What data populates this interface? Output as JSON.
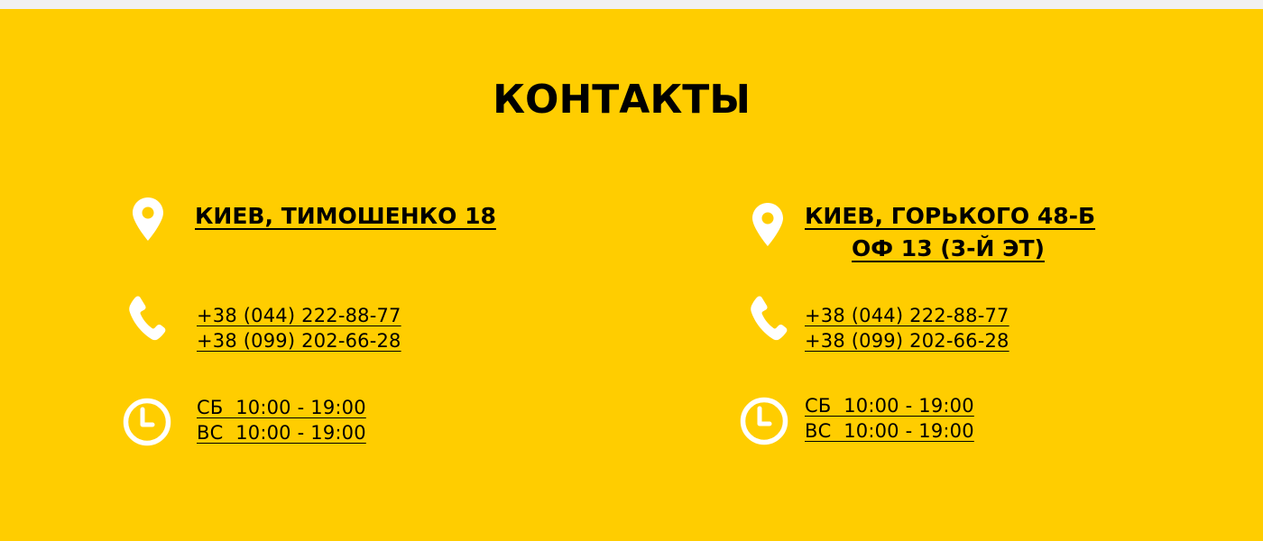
{
  "title": "КОНТАКТЫ",
  "colors": {
    "background": "#ffcd00",
    "page_top": "#f1f1f1",
    "text": "#000000",
    "icon": "#ffffff"
  },
  "locations": [
    {
      "address_lines": [
        "КИЕВ, ТИМОШЕНКО 18"
      ],
      "phones": [
        "+38 (044) 222-88-77",
        "+38 (099) 202-66-28"
      ],
      "hours": [
        "СБ  10:00 - 19:00",
        "ВС  10:00 - 19:00"
      ],
      "icons": [
        "map-pin-icon",
        "phone-icon",
        "clock-icon"
      ]
    },
    {
      "address_lines": [
        "КИЕВ, ГОРЬКОГО 48-Б",
        "ОФ 13 (3-Й ЭТ)"
      ],
      "phones": [
        "+38 (044) 222-88-77",
        "+38 (099) 202-66-28"
      ],
      "hours": [
        "СБ  10:00 - 19:00",
        "ВС  10:00 - 19:00"
      ],
      "icons": [
        "map-pin-icon",
        "phone-icon",
        "clock-icon"
      ]
    }
  ]
}
